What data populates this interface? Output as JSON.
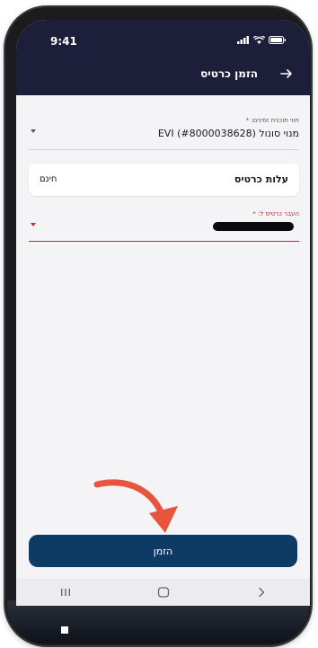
{
  "status_bar": {
    "time": "9:41"
  },
  "header": {
    "title": "הזמן כרטיס",
    "back_icon": "arrow-right-icon"
  },
  "form": {
    "program_field": {
      "label": "חווי תוכנית זמינים: *",
      "value": "מנוי סונול (#8000038628) EVI"
    },
    "cost": {
      "label": "עלות כרטיס",
      "value": "חינם"
    },
    "transfer_field": {
      "label": "העבר כרטיס ל: *",
      "value_redacted": true
    }
  },
  "actions": {
    "order_label": "הזמן"
  },
  "nav": {
    "recents_icon": "recents-icon",
    "home_icon": "home-icon",
    "back_icon": "chevron-right-icon"
  },
  "colors": {
    "header_bg": "#1d1f3a",
    "button_bg": "#0e3a66",
    "error_red": "#c62828",
    "annotation_arrow": "#e8553f"
  }
}
